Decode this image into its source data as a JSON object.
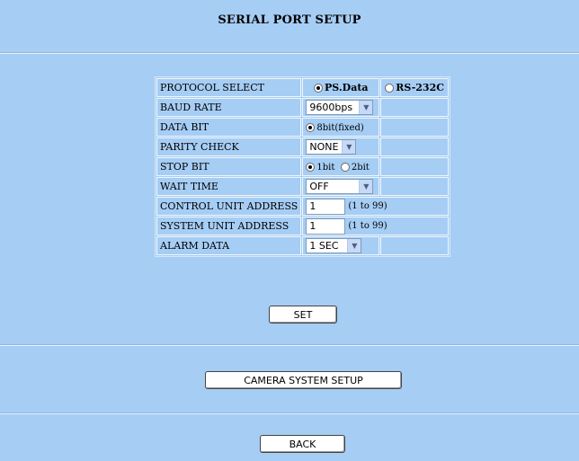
{
  "page": {
    "title": "SERIAL PORT SETUP"
  },
  "protocol": {
    "label": "PROTOCOL SELECT",
    "options": [
      "PS.Data",
      "RS-232C"
    ],
    "selected": "PS.Data"
  },
  "baud_rate": {
    "label": "BAUD RATE",
    "value": "9600bps"
  },
  "data_bit": {
    "label": "DATA BIT",
    "option": "8bit(fixed)"
  },
  "parity_check": {
    "label": "PARITY CHECK",
    "value": "NONE"
  },
  "stop_bit": {
    "label": "STOP BIT",
    "options": [
      "1bit",
      "2bit"
    ],
    "selected": "1bit"
  },
  "wait_time": {
    "label": "WAIT TIME",
    "value": "OFF"
  },
  "control_unit_address": {
    "label": "CONTROL UNIT ADDRESS",
    "value": "1",
    "hint": "(1 to 99)"
  },
  "system_unit_address": {
    "label": "SYSTEM UNIT ADDRESS",
    "value": "1",
    "hint": "(1 to 99)"
  },
  "alarm_data": {
    "label": "ALARM DATA",
    "value": "1 SEC"
  },
  "buttons": {
    "set": "SET",
    "camera_system_setup": "CAMERA SYSTEM SETUP",
    "back": "BACK"
  }
}
